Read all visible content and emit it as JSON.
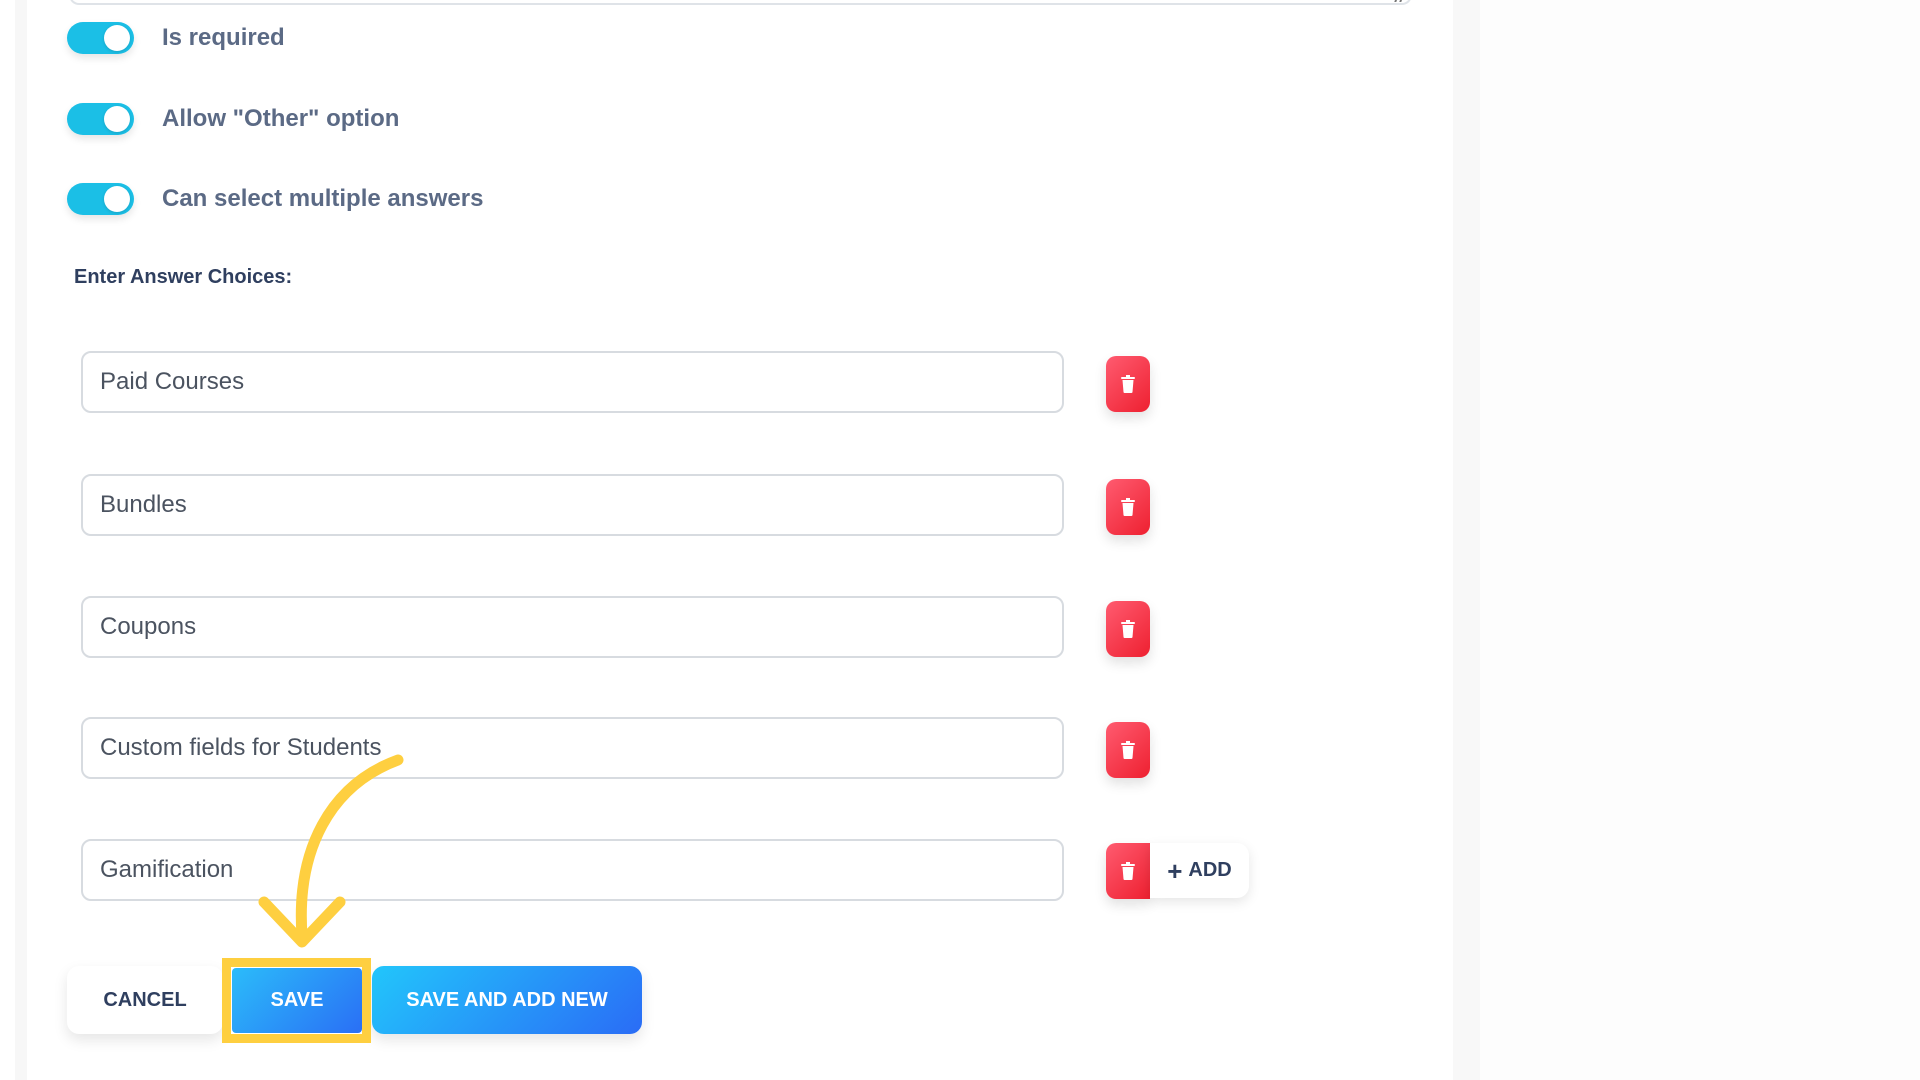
{
  "toggles": [
    {
      "label": "Is required",
      "on": true
    },
    {
      "label": "Allow \"Other\" option",
      "on": true
    },
    {
      "label": "Can select multiple answers",
      "on": true
    }
  ],
  "answer_section": {
    "label": "Enter Answer Choices:",
    "choices": [
      {
        "value": "Paid Courses"
      },
      {
        "value": "Bundles"
      },
      {
        "value": "Coupons"
      },
      {
        "value": "Custom fields for Students"
      },
      {
        "value": "Gamification"
      }
    ],
    "add_label": "ADD",
    "add_icon": "plus-icon",
    "delete_icon": "trash-icon"
  },
  "actions": {
    "cancel_label": "CANCEL",
    "save_label": "SAVE",
    "save_new_label": "SAVE AND ADD NEW"
  },
  "annotation": {
    "type": "curved-arrow",
    "target": "save-button",
    "color": "#fecf40"
  },
  "colors": {
    "toggle_on": "#1bbfe6",
    "delete": "#ee2030",
    "primary_start": "#2bbcfa",
    "primary_end": "#2a6ff5",
    "highlight": "#fecf40"
  }
}
